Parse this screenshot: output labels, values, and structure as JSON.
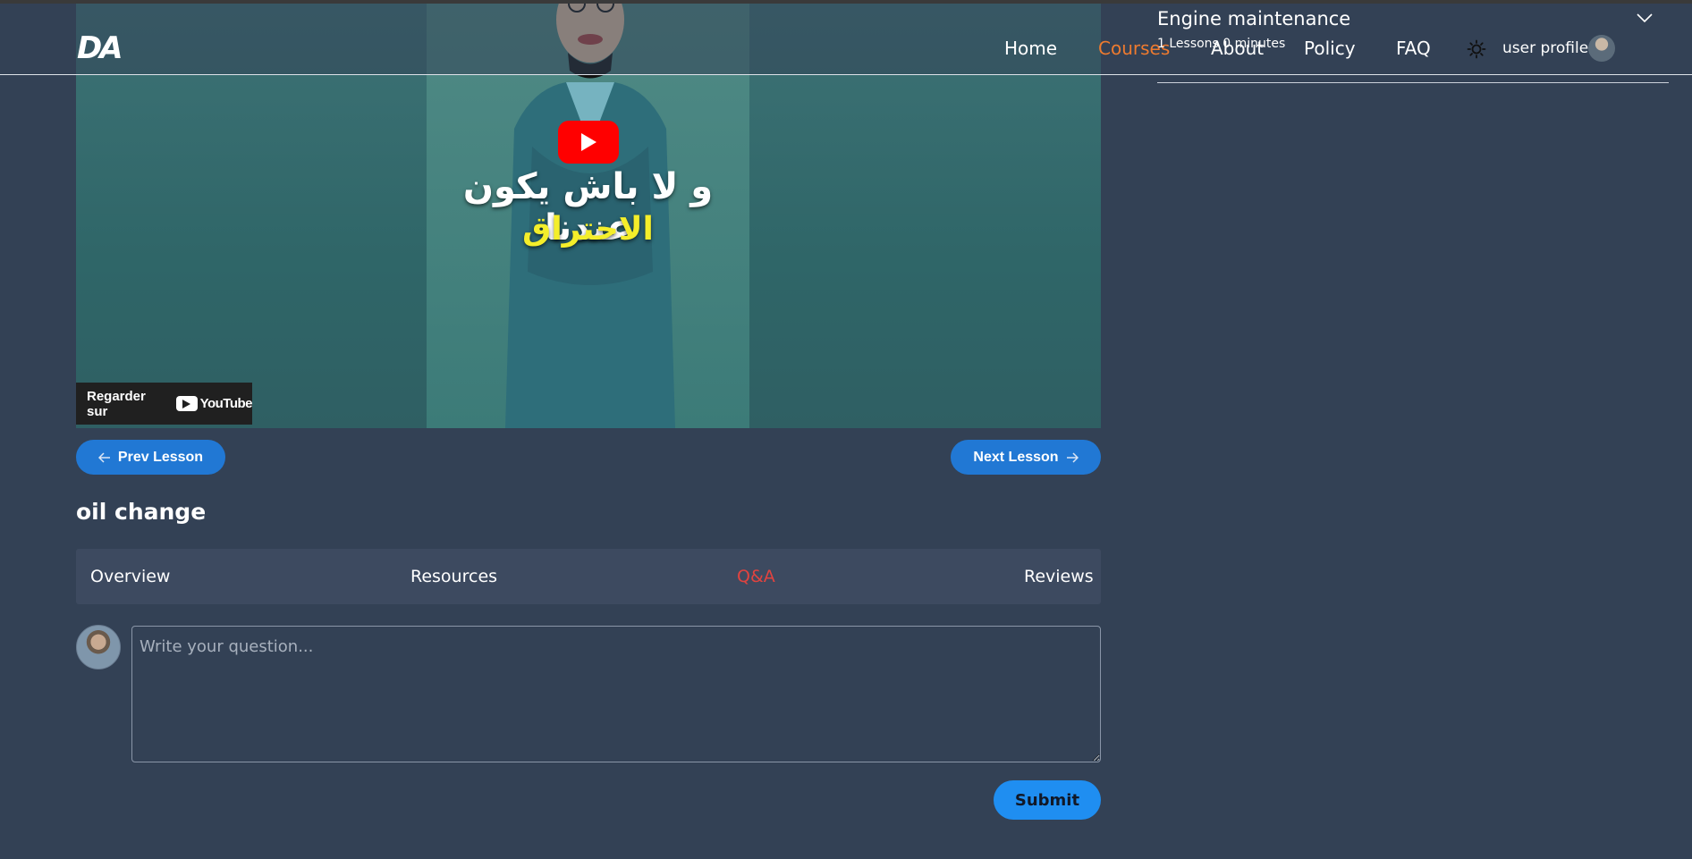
{
  "navbar": {
    "logo": "DA",
    "links": [
      {
        "label": "Home"
      },
      {
        "label": "Courses"
      },
      {
        "label": "About"
      },
      {
        "label": "Policy"
      },
      {
        "label": "FAQ"
      }
    ],
    "active_link": "Courses",
    "user_label": "user profile"
  },
  "course": {
    "title": "Engine maintenance",
    "meta": "1 Lessons 0 minutes"
  },
  "video": {
    "caption_line_1": "و لا باش يكون عندنا",
    "caption_line_2": "الاحتراق",
    "watch_on_label": "Regarder sur",
    "youtube_word": "YouTube"
  },
  "lesson": {
    "prev_label": "Prev Lesson",
    "next_label": "Next Lesson",
    "title": "oil change"
  },
  "tabs": [
    {
      "label": "Overview"
    },
    {
      "label": "Resources"
    },
    {
      "label": "Q&A"
    },
    {
      "label": "Reviews"
    }
  ],
  "active_tab": "Q&A",
  "question": {
    "placeholder": "Write your question...",
    "value": "",
    "submit_label": "Submit"
  },
  "colors": {
    "background": "#334155",
    "accent_blue": "#2178d4",
    "active_nav": "#ee7a2f",
    "active_tab": "#e1433f",
    "submit": "#1f8ef1"
  }
}
